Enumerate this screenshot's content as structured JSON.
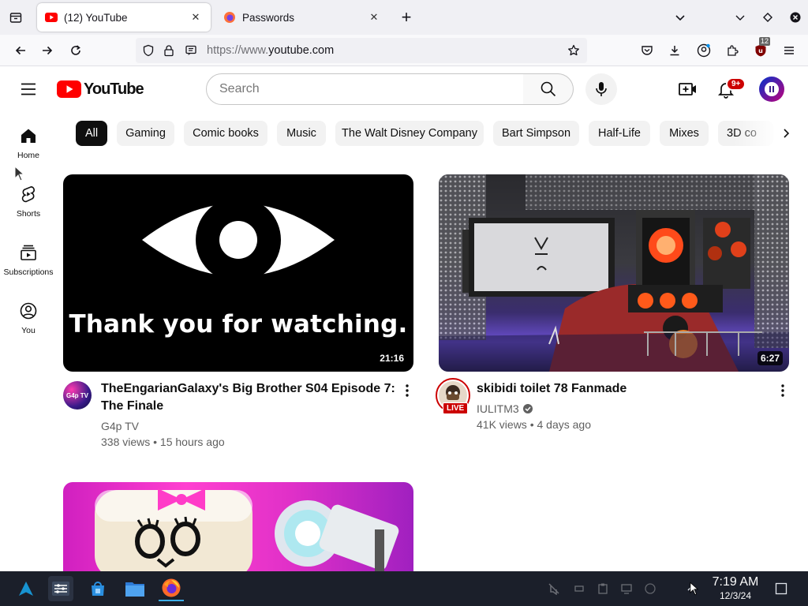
{
  "browser": {
    "tabs": [
      {
        "title": "(12) YouTube",
        "active": true
      },
      {
        "title": "Passwords",
        "active": false
      }
    ],
    "new_tab": "+",
    "url": {
      "scheme": "https://www.",
      "host": "youtube.com"
    },
    "extension_badge": "12"
  },
  "yt": {
    "logo_text": "YouTube",
    "search_placeholder": "Search",
    "notification_count": "9+",
    "avatar_initial": "",
    "brand_red": "#ff0000"
  },
  "sidebar": {
    "items": [
      {
        "label": "Home",
        "icon": "home-icon"
      },
      {
        "label": "Shorts",
        "icon": "shorts-icon"
      },
      {
        "label": "Subscriptions",
        "icon": "subscriptions-icon"
      },
      {
        "label": "You",
        "icon": "you-icon"
      }
    ]
  },
  "chips": [
    "All",
    "Gaming",
    "Comic books",
    "Music",
    "The Walt Disney Company",
    "Bart Simpson",
    "Half-Life",
    "Mixes",
    "3D co"
  ],
  "videos": [
    {
      "title_line1": "TheEngarianGalaxy's Big Brother S04 Episode 7:",
      "title_line2": "The Finale",
      "channel": "G4p TV",
      "stats": "338 views • 15 hours ago",
      "duration": "21:16",
      "thumb_text": "Thank you for watching.",
      "avatar_text": "G4p TV"
    },
    {
      "title_line1": "skibidi toilet 78 Fanmade",
      "title_line2": "",
      "channel": "IULITM3",
      "stats": "41K views • 4 days ago",
      "duration": "6:27",
      "live_badge": "LIVE"
    }
  ],
  "taskbar": {
    "time": "7:19 AM",
    "date": "12/3/24"
  }
}
